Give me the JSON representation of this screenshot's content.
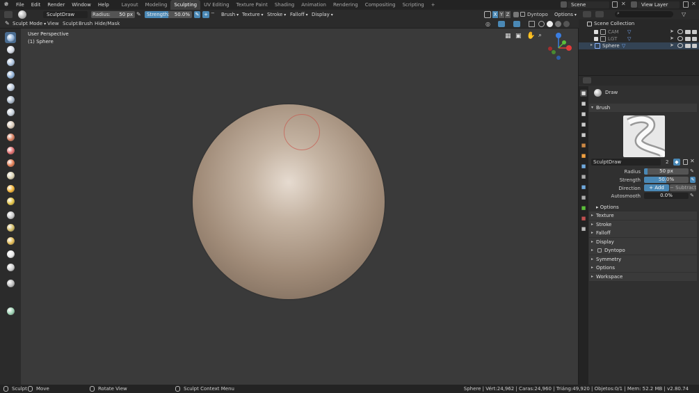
{
  "menubar": {
    "items": [
      "File",
      "Edit",
      "Render",
      "Window",
      "Help"
    ],
    "workspaces": [
      "Layout",
      "Modeling",
      "Sculpting",
      "UV Editing",
      "Texture Paint",
      "Shading",
      "Animation",
      "Rendering",
      "Compositing",
      "Scripting"
    ],
    "active_workspace": "Sculpting",
    "add_tab": "+",
    "scene": "Scene",
    "view_layer": "View Layer"
  },
  "tool_header": {
    "brush_name": "SculptDraw",
    "radius_label": "Radius:",
    "radius_value": "50 px",
    "strength_label": "Strength:",
    "strength_value": "50.0%",
    "strength_fraction": 0.5,
    "plus_minus": [
      "+",
      "−"
    ],
    "menus": [
      "Brush",
      "Texture",
      "Stroke",
      "Falloff",
      "Display"
    ],
    "xyz": [
      "X",
      "Y",
      "Z"
    ],
    "dyntopo": "Dyntopo",
    "options": "Options"
  },
  "mode_header": {
    "mode": "Sculpt Mode",
    "menus": [
      "View",
      "Sculpt",
      "Brush",
      "Hide/Mask"
    ]
  },
  "viewport": {
    "perspective": "User Perspective",
    "object": "(1) Sphere",
    "sphere_color": "#b7a694"
  },
  "tools": [
    "draw-icon",
    "clay-icon",
    "clay-strips-icon",
    "layer-icon",
    "inflate-icon",
    "blob-icon",
    "crease-icon",
    "smooth-icon",
    "flatten-icon",
    "fill-icon",
    "scrape-icon",
    "pinch-icon",
    "grab-icon",
    "snake-hook-icon",
    "thumb-icon",
    "nudge-icon",
    "rotate-icon",
    "simplify-icon",
    "mask-icon",
    "box-mask-icon",
    "annotate-icon"
  ],
  "outliner": {
    "root": "Scene Collection",
    "items": [
      {
        "name": "CAM",
        "icon": "camera-icon"
      },
      {
        "name": "LGT",
        "icon": "light-icon"
      },
      {
        "name": "Sphere",
        "icon": "mesh-icon"
      }
    ]
  },
  "properties": {
    "brush_header": "Draw",
    "brush_panel": "Brush",
    "brush_name_field": "SculptDraw",
    "users": "2",
    "radius_label": "Radius",
    "radius_value": "50 px",
    "radius_fraction": 0.08,
    "strength_label": "Strength",
    "strength_value": "50.0%",
    "strength_fraction": 0.5,
    "direction_label": "Direction",
    "direction_add": "Add",
    "direction_subtract": "Subtract",
    "autosmooth_label": "Autosmooth",
    "autosmooth_value": "0.0%",
    "options_sub": "Options",
    "panels": [
      "Texture",
      "Stroke",
      "Falloff",
      "Display",
      "Dyntopo",
      "Symmetry",
      "Options",
      "Workspace"
    ]
  },
  "statusbar": {
    "left": [
      "Sculpt",
      "Move",
      "Rotate View",
      "Sculpt Context Menu"
    ],
    "right": "Sphere | Vért:24,962 | Caras:24,960 | Triáng:49,920 | Objetos:0/1 | Mem: 52.2 MB | v2.80.74"
  },
  "colors": {
    "accent": "#4a6c90",
    "gizmo_x": "#e03a3a",
    "gizmo_y": "#5bbf3a",
    "gizmo_z": "#3a7de0"
  }
}
